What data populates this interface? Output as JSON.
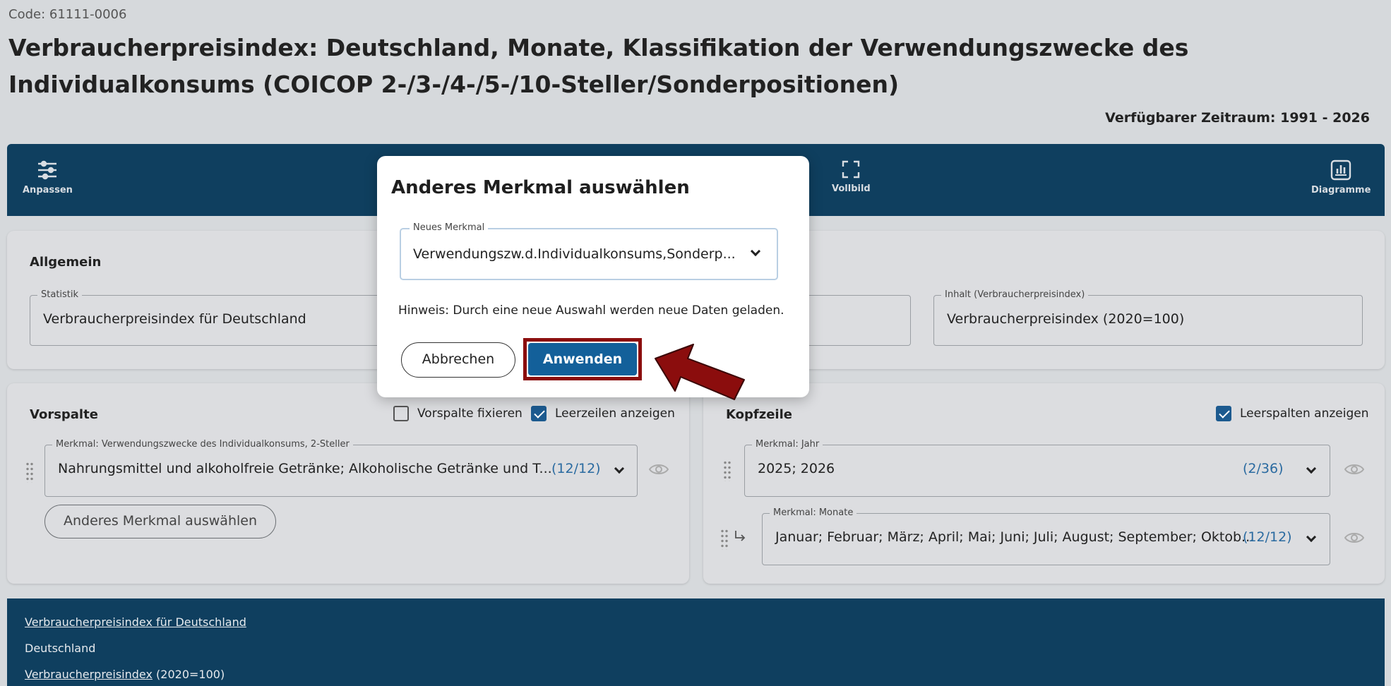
{
  "header": {
    "code": "Code: 61111-0006",
    "title": "Verbraucherpreisindex: Deutschland, Monate, Klassifikation der Verwendungszwecke des Individualkonsums (COICOP 2-/3-/4-/5-/10-Steller/Sonderpositionen)",
    "zeitraum": "Verfügbarer Zeitraum: 1991 - 2026"
  },
  "toolbar": {
    "anpassen": "Anpassen",
    "vollbild": "Vollbild",
    "diagramme": "Diagramme"
  },
  "allgemein": {
    "heading": "Allgemein",
    "statistik_legend": "Statistik",
    "statistik_value": "Verbraucherpreisindex für Deutschland",
    "inhalt_legend": "Inhalt (Verbraucherpreisindex)",
    "inhalt_value": "Verbraucherpreisindex (2020=100)"
  },
  "vorspalte": {
    "heading": "Vorspalte",
    "fix_label": "Vorspalte fixieren",
    "leerzeilen_label": "Leerzeilen anzeigen",
    "merkmal_legend": "Merkmal: Verwendungszwecke des Individualkonsums, 2-Steller",
    "merkmal_value": "Nahrungsmittel und alkoholfreie Getränke; Alkoholische Getränke und T...",
    "merkmal_count": "(12/12)",
    "other_button": "Anderes Merkmal auswählen"
  },
  "kopfzeile": {
    "heading": "Kopfzeile",
    "leerspalten_label": "Leerspalten anzeigen",
    "jahr_legend": "Merkmal: Jahr",
    "jahr_value": "2025; 2026",
    "jahr_count": "(2/36)",
    "monate_legend": "Merkmal: Monate",
    "monate_value": "Januar; Februar; März; April; Mai; Juni; Juli; August; September; Oktob...",
    "monate_count": "(12/12)"
  },
  "footer": {
    "line1": "Verbraucherpreisindex für Deutschland",
    "line2": "Deutschland",
    "line3_link": "Verbraucherpreisindex",
    "line3_rest": " (2020=100)"
  },
  "dialog": {
    "title": "Anderes Merkmal auswählen",
    "field_legend": "Neues Merkmal",
    "field_value": "Verwendungszw.d.Individualkonsums,Sonderp...",
    "hint": "Hinweis: Durch eine neue Auswahl werden neue Daten geladen.",
    "cancel": "Abbrechen",
    "apply": "Anwenden"
  },
  "colors": {
    "navy": "#0f3f5f",
    "accent": "#13609a",
    "highlight": "#8b0d0d"
  },
  "icons": [
    "sliders-icon",
    "fullscreen-icon",
    "bar-chart-icon",
    "chevron-down-icon",
    "eye-icon",
    "drag-handle-icon",
    "subitem-arrow-icon",
    "annotation-arrow"
  ]
}
